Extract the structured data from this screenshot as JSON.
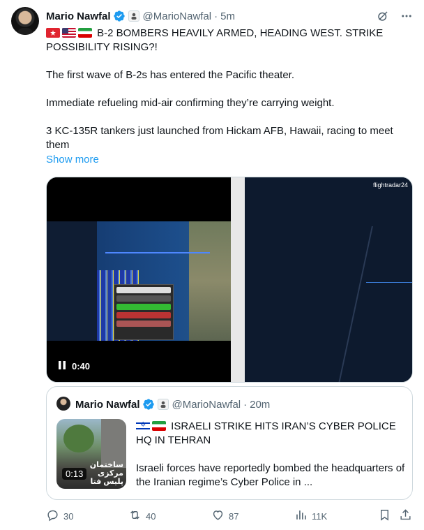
{
  "author": {
    "name": "Mario Nawfal",
    "handle": "@MarioNawfal",
    "time": "5m"
  },
  "tweet": {
    "line1": "B-2 BOMBERS HEAVILY ARMED, HEADING WEST. STRIKE POSSIBILITY RISING?!",
    "para2": "The first wave of B-2s has entered the Pacific theater.",
    "para3": "Immediate refueling mid-air confirming they’re carrying weight.",
    "para4": "3 KC-135R tankers just launched from Hickam AFB, Hawaii, racing to meet them",
    "show_more": "Show more"
  },
  "video": {
    "duration": "0:40",
    "right_logo": "flightradar24"
  },
  "quote": {
    "name": "Mario Nawfal",
    "handle": "@MarioNawfal",
    "time": "20m",
    "headline": "ISRAELI STRIKE HITS IRAN’S CYBER POLICE HQ IN TEHRAN",
    "body": "Israeli forces have reportedly bombed the headquarters of the Iranian regime’s Cyber Police in ...",
    "video_duration": "0:13",
    "thumb_caption": "ساختمان مرکزی پلیس فتا"
  },
  "actions": {
    "replies": "30",
    "reposts": "40",
    "likes": "87",
    "views": "11K"
  }
}
